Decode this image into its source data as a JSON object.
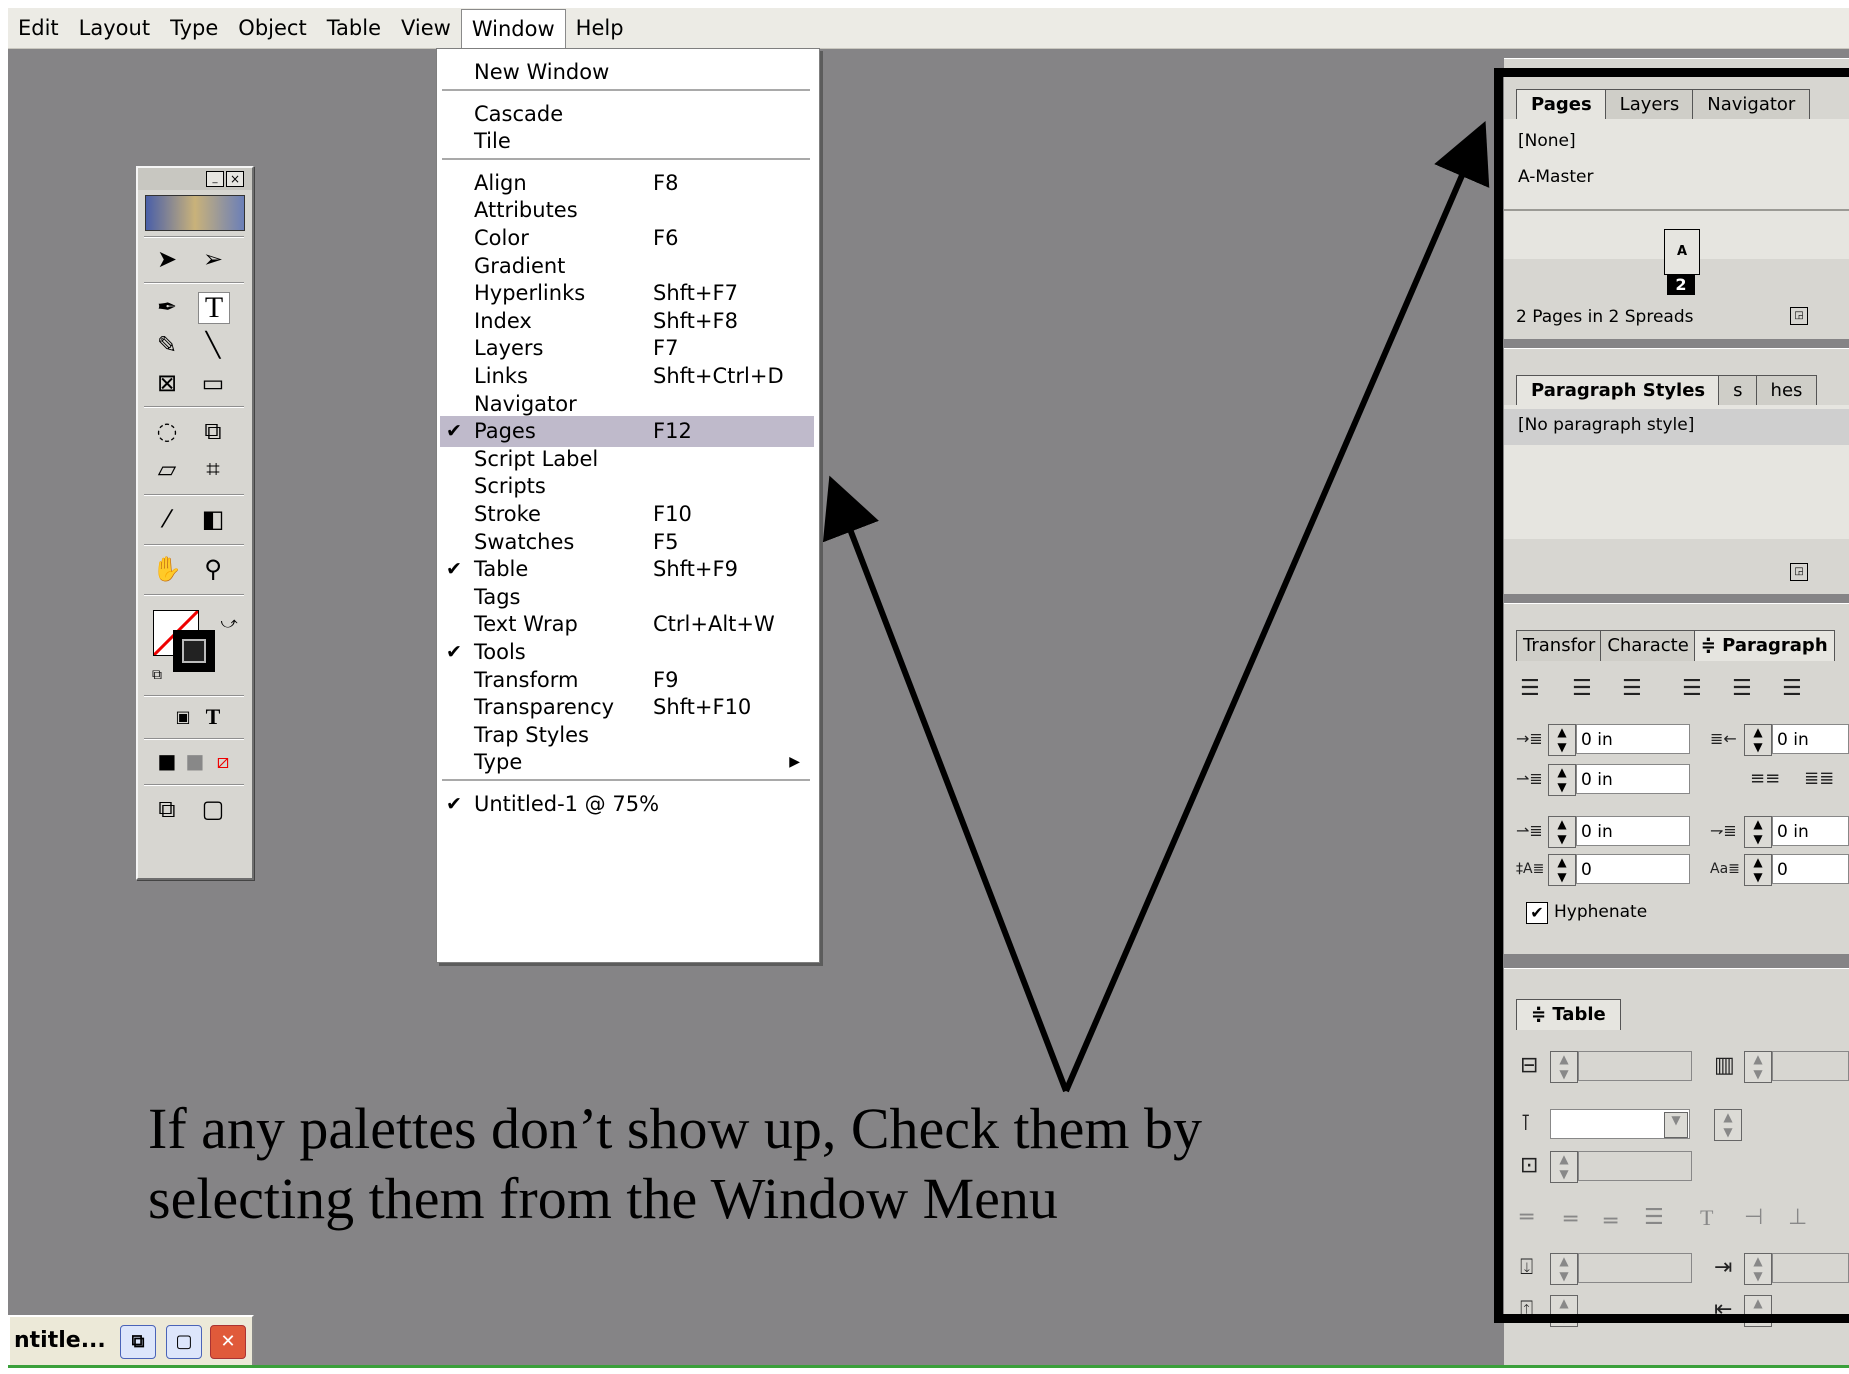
{
  "menubar": {
    "items": [
      "Edit",
      "Layout",
      "Type",
      "Object",
      "Table",
      "View",
      "Window",
      "Help"
    ]
  },
  "window_menu": {
    "groups": [
      [
        {
          "label": "New Window",
          "shortcut": "",
          "checked": false
        }
      ],
      [
        {
          "label": "Cascade",
          "shortcut": "",
          "checked": false
        },
        {
          "label": "Tile",
          "shortcut": "",
          "checked": false
        }
      ],
      [
        {
          "label": "Align",
          "shortcut": "F8",
          "checked": false
        },
        {
          "label": "Attributes",
          "shortcut": "",
          "checked": false
        },
        {
          "label": "Color",
          "shortcut": "F6",
          "checked": false
        },
        {
          "label": "Gradient",
          "shortcut": "",
          "checked": false
        },
        {
          "label": "Hyperlinks",
          "shortcut": "Shft+F7",
          "checked": false
        },
        {
          "label": "Index",
          "shortcut": "Shft+F8",
          "checked": false
        },
        {
          "label": "Layers",
          "shortcut": "F7",
          "checked": false
        },
        {
          "label": "Links",
          "shortcut": "Shft+Ctrl+D",
          "checked": false
        },
        {
          "label": "Navigator",
          "shortcut": "",
          "checked": false
        },
        {
          "label": "Pages",
          "shortcut": "F12",
          "checked": true,
          "highlighted": true
        },
        {
          "label": "Script Label",
          "shortcut": "",
          "checked": false
        },
        {
          "label": "Scripts",
          "shortcut": "",
          "checked": false
        },
        {
          "label": "Stroke",
          "shortcut": "F10",
          "checked": false
        },
        {
          "label": "Swatches",
          "shortcut": "F5",
          "checked": false
        },
        {
          "label": "Table",
          "shortcut": "Shft+F9",
          "checked": true
        },
        {
          "label": "Tags",
          "shortcut": "",
          "checked": false
        },
        {
          "label": "Text Wrap",
          "shortcut": "Ctrl+Alt+W",
          "checked": false
        },
        {
          "label": "Tools",
          "shortcut": "",
          "checked": true
        },
        {
          "label": "Transform",
          "shortcut": "F9",
          "checked": false
        },
        {
          "label": "Transparency",
          "shortcut": "Shft+F10",
          "checked": false
        },
        {
          "label": "Trap Styles",
          "shortcut": "",
          "checked": false
        },
        {
          "label": "Type",
          "shortcut": "",
          "checked": false,
          "submenu": true
        }
      ],
      [
        {
          "label": "Untitled-1 @ 75%",
          "shortcut": "",
          "checked": true
        }
      ]
    ]
  },
  "pages_panel": {
    "tabs": [
      "Pages",
      "Layers",
      "Navigator"
    ],
    "none_label": "[None]",
    "master_label": "A-Master",
    "page_letter": "A",
    "page_number": "2",
    "status": "2 Pages in 2 Spreads"
  },
  "para_styles_panel": {
    "tabs": [
      "Paragraph Styles",
      "s",
      "hes"
    ],
    "item": "[No paragraph style]"
  },
  "paragraph_panel": {
    "tabs": [
      "Transfor",
      "Characte",
      "≑ Paragraph"
    ],
    "left_indent": "0 in",
    "right_indent": "0 in",
    "first_indent": "0 in",
    "space_before": "0 in",
    "space_after": "0 in",
    "drop_lines": "0",
    "drop_chars": "0",
    "hyphenate_label": "Hyphenate",
    "hyphenate_checked": true
  },
  "table_panel": {
    "tab": "≑ Table"
  },
  "caption": {
    "line1": "If any palettes don’t show up, Check them by",
    "line2": "selecting them from the Window Menu"
  },
  "taskbar": {
    "title": "ntitle..."
  },
  "colors": {
    "workspace": "#858486",
    "menu_highlight": "#bfbacb",
    "panel_bg": "#d7d6d1"
  }
}
